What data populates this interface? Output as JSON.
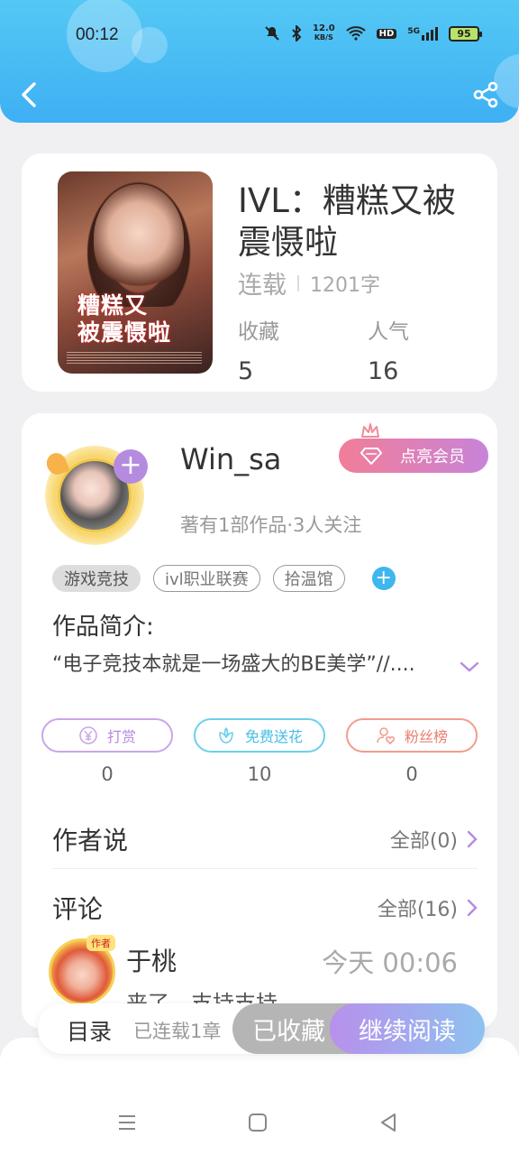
{
  "status_bar": {
    "time": "00:12",
    "net_speed_value": "12.0",
    "net_speed_unit": "KB/S",
    "hd_label": "HD",
    "signal_label": "5G",
    "battery": "95"
  },
  "header": {
    "back_icon": "chevron-left-icon",
    "share_icon": "share-icon",
    "color": "#47bdf4"
  },
  "book": {
    "cover_title_line1": "糟糕又",
    "cover_title_line2": "被震慑啦",
    "title": "IVL：糟糕又被震慑啦",
    "status": "连载",
    "word_count": "1201字",
    "stats": [
      {
        "label": "收藏",
        "value": "5"
      },
      {
        "label": "人气",
        "value": "16"
      }
    ]
  },
  "author": {
    "name": "Win_sa",
    "description": "著有1部作品·3人关注",
    "vip_button": "点亮会员",
    "follow_icon": "plus-icon"
  },
  "tags": [
    "游戏竞技",
    "ivl职业联赛",
    "拾温馆"
  ],
  "intro": {
    "label": "作品简介:",
    "text": "“电子竞技本就是一场盛大的BE美学”//...."
  },
  "actions": [
    {
      "label": "打赏",
      "count": "0",
      "icon": "yen-coin-icon",
      "color": "#b58be0"
    },
    {
      "label": "免费送花",
      "count": "10",
      "icon": "flower-icon",
      "color": "#46bee4"
    },
    {
      "label": "粉丝榜",
      "count": "0",
      "icon": "user-heart-icon",
      "color": "#ea7e6e"
    }
  ],
  "author_says": {
    "title": "作者说",
    "link": "全部(0)"
  },
  "comments": {
    "title": "评论",
    "link": "全部(16)",
    "items": [
      {
        "badge": "作者",
        "name": "于桃",
        "time": "今天 00:06",
        "text": "来了，支持支持"
      }
    ]
  },
  "bottom_bar": {
    "toc": "目录",
    "toc_sub": "已连载1章",
    "favorited": "已收藏",
    "continue_reading": "继续阅读"
  }
}
